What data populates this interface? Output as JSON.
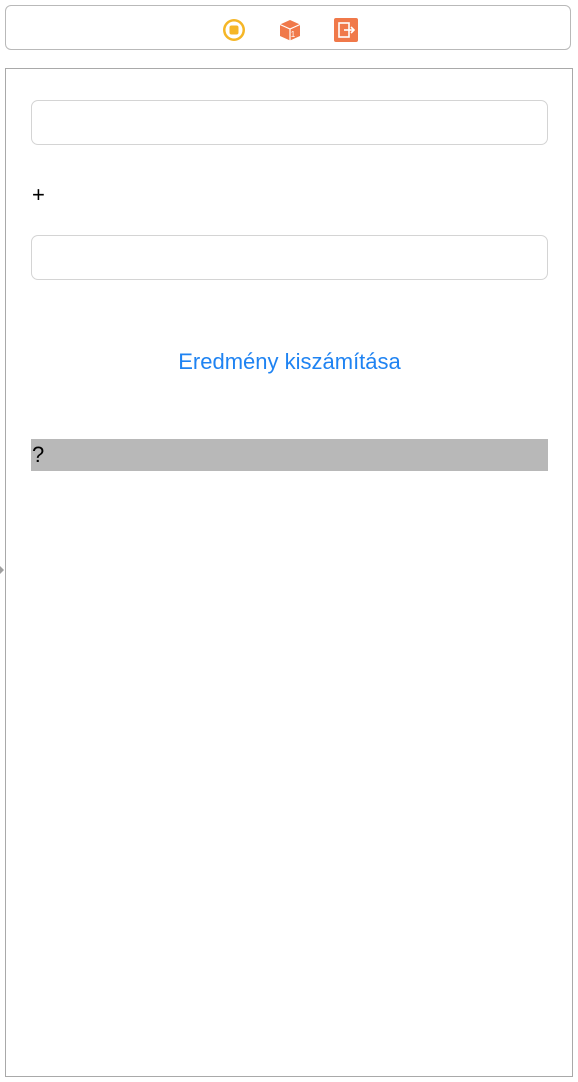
{
  "scene_dock": {
    "icons": [
      {
        "name": "view-controller-icon",
        "color": "#f5b626"
      },
      {
        "name": "first-responder-icon",
        "color": "#f0794a"
      },
      {
        "name": "exit-icon",
        "color": "#f0794a"
      }
    ]
  },
  "form": {
    "first_number": {
      "value": "",
      "placeholder": ""
    },
    "operator_label": "+",
    "second_number": {
      "value": "",
      "placeholder": ""
    },
    "calculate_button_label": "Eredmény kiszámítása",
    "result_label": "?"
  },
  "colors": {
    "accent": "#1f83f2",
    "result_background": "#b8b8b8"
  }
}
